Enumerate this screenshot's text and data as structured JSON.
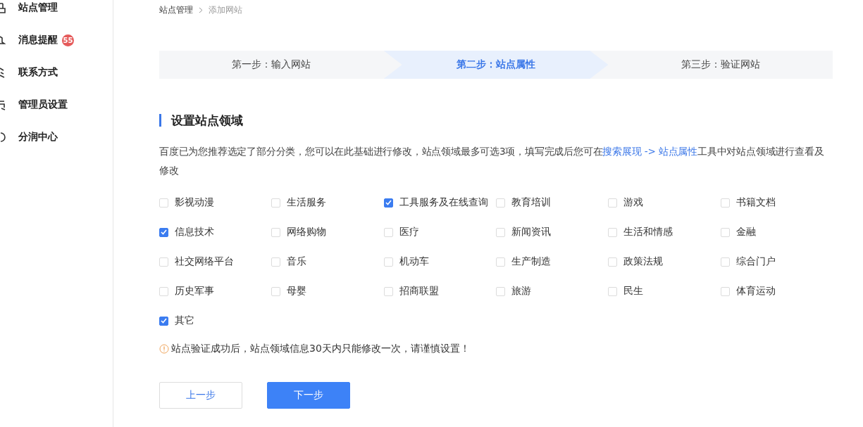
{
  "sidebar": {
    "items": [
      {
        "label": "站点管理"
      },
      {
        "label": "消息提醒",
        "badge": "55"
      },
      {
        "label": "联系方式"
      },
      {
        "label": "管理员设置"
      },
      {
        "label": "分润中心"
      }
    ]
  },
  "breadcrumb": [
    "站点管理",
    "添加网站"
  ],
  "steps": [
    {
      "label": "第一步：输入网站",
      "selected": false
    },
    {
      "label": "第二步：站点属性",
      "selected": true
    },
    {
      "label": "第三步：验证网站",
      "selected": false
    }
  ],
  "section_title": "设置站点领域",
  "description": {
    "text_before": "百度已为您推荐选定了部分分类，您可以在此基础进行修改，站点领域最多可选3项，填写完成后您可在",
    "link": "搜索展现 -> 站点属性",
    "text_after": "工具中对站点领域进行查看及修改"
  },
  "categories": [
    {
      "label": "影视动漫",
      "checked": false
    },
    {
      "label": "生活服务",
      "checked": false
    },
    {
      "label": "工具服务及在线查询",
      "checked": true
    },
    {
      "label": "教育培训",
      "checked": false
    },
    {
      "label": "游戏",
      "checked": false
    },
    {
      "label": "书籍文档",
      "checked": false
    },
    {
      "label": "信息技术",
      "checked": true
    },
    {
      "label": "网络购物",
      "checked": false
    },
    {
      "label": "医疗",
      "checked": false
    },
    {
      "label": "新闻资讯",
      "checked": false
    },
    {
      "label": "生活和情感",
      "checked": false
    },
    {
      "label": "金融",
      "checked": false
    },
    {
      "label": "社交网络平台",
      "checked": false
    },
    {
      "label": "音乐",
      "checked": false
    },
    {
      "label": "机动车",
      "checked": false
    },
    {
      "label": "生产制造",
      "checked": false
    },
    {
      "label": "政策法规",
      "checked": false
    },
    {
      "label": "综合门户",
      "checked": false
    },
    {
      "label": "历史军事",
      "checked": false
    },
    {
      "label": "母婴",
      "checked": false
    },
    {
      "label": "招商联盟",
      "checked": false
    },
    {
      "label": "旅游",
      "checked": false
    },
    {
      "label": "民生",
      "checked": false
    },
    {
      "label": "体育运动",
      "checked": false
    },
    {
      "label": "其它",
      "checked": true
    }
  ],
  "warning": "站点验证成功后，站点领域信息30天内只能修改一次，请谨慎设置！",
  "buttons": {
    "prev": "上一步",
    "next": "下一步"
  }
}
